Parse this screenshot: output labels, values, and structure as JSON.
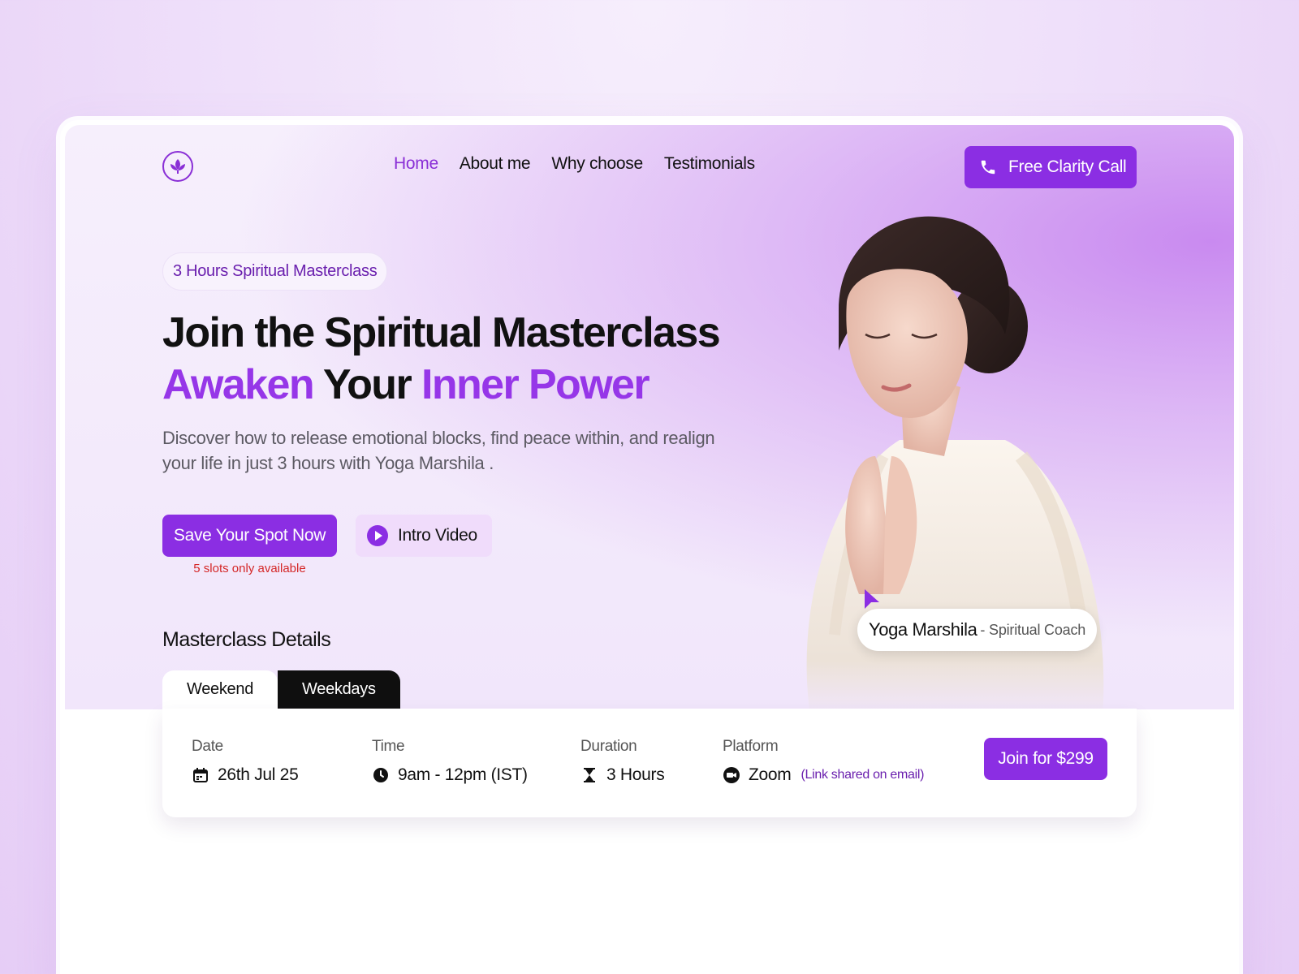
{
  "nav": {
    "items": [
      {
        "label": "Home",
        "active": true
      },
      {
        "label": "About me",
        "active": false
      },
      {
        "label": "Why choose",
        "active": false
      },
      {
        "label": "Testimonials",
        "active": false
      }
    ],
    "cta_label": "Free Clarity Call",
    "logo_icon": "lotus-icon"
  },
  "hero": {
    "badge": "3 Hours Spiritual Masterclass",
    "title_line1": "Join the Spiritual Masterclass",
    "title_line2_a": "Awaken",
    "title_line2_b": "Your",
    "title_line2_c": "Inner Power",
    "description": "Discover how to release emotional blocks, find peace within, and realign your life in just 3 hours with Yoga Marshila .",
    "primary_button": "Save Your Spot Now",
    "slots_note": "5 slots only available",
    "video_button": "Intro Video"
  },
  "coach": {
    "name": "Yoga Marshila",
    "role": "- Spiritual Coach"
  },
  "details": {
    "title": "Masterclass Details",
    "tabs": [
      "Weekend",
      "Weekdays"
    ],
    "active_tab": "Weekdays",
    "date_label": "Date",
    "date_value": "26th Jul 25",
    "time_label": "Time",
    "time_value": "9am - 12pm (IST)",
    "duration_label": "Duration",
    "duration_value": "3 Hours",
    "platform_label": "Platform",
    "platform_value": "Zoom",
    "platform_note": "(Link shared on email)",
    "join_button": "Join for $299"
  },
  "colors": {
    "accent": "#8b2ee3",
    "accent_text": "#9636e8",
    "alert": "#d42626",
    "dark": "#0f0f0f"
  }
}
